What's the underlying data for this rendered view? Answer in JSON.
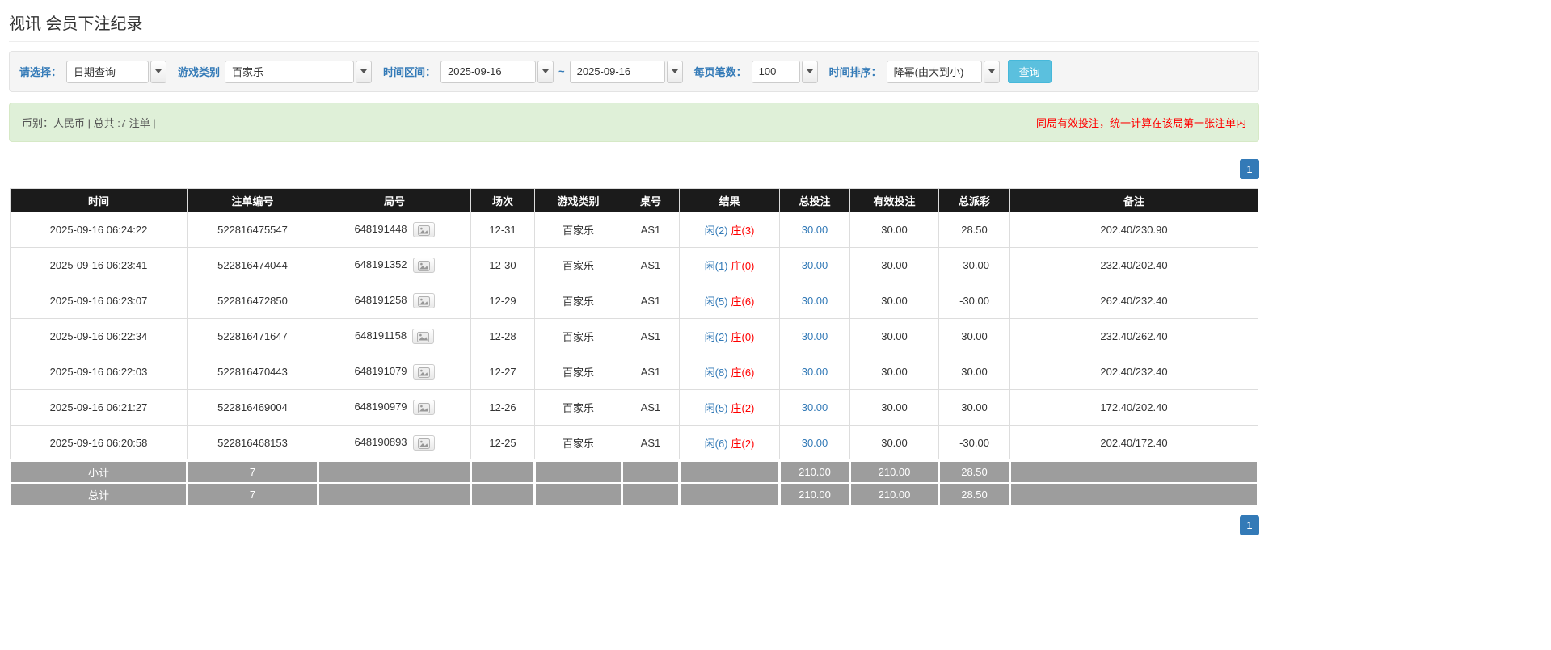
{
  "page": {
    "title": "视讯 会员下注纪录"
  },
  "filters": {
    "select_label": "请选择：",
    "select_value": "日期查询",
    "game_label": "游戏类别",
    "game_value": "百家乐",
    "range_label": "时间区间：",
    "date_from": "2025-09-16",
    "range_separator": "~",
    "date_to": "2025-09-16",
    "per_page_label": "每页笔数：",
    "per_page_value": "100",
    "sort_label": "时间排序：",
    "sort_value": "降幂(由大到小)",
    "search_label": "查询"
  },
  "summary": {
    "left_text": "币别：人民币 | 总共 :7 注单 |",
    "right_text": "同局有效投注，统一计算在该局第一张注单内"
  },
  "pagination": {
    "page": "1"
  },
  "table": {
    "headers": [
      "时间",
      "注单编号",
      "局号",
      "场次",
      "游戏类别",
      "桌号",
      "结果",
      "总投注",
      "有效投注",
      "总派彩",
      "备注"
    ],
    "rows": [
      {
        "time": "2025-09-16 06:24:22",
        "bet_id": "522816475547",
        "round_id": "648191448",
        "session": "12-31",
        "game_type": "百家乐",
        "table_no": "AS1",
        "result_player": "闲(2)",
        "result_banker": "庄(3)",
        "total_bet": "30.00",
        "valid_bet": "30.00",
        "payout": "28.50",
        "note": "202.40/230.90"
      },
      {
        "time": "2025-09-16 06:23:41",
        "bet_id": "522816474044",
        "round_id": "648191352",
        "session": "12-30",
        "game_type": "百家乐",
        "table_no": "AS1",
        "result_player": "闲(1)",
        "result_banker": "庄(0)",
        "total_bet": "30.00",
        "valid_bet": "30.00",
        "payout": "-30.00",
        "note": "232.40/202.40"
      },
      {
        "time": "2025-09-16 06:23:07",
        "bet_id": "522816472850",
        "round_id": "648191258",
        "session": "12-29",
        "game_type": "百家乐",
        "table_no": "AS1",
        "result_player": "闲(5)",
        "result_banker": "庄(6)",
        "total_bet": "30.00",
        "valid_bet": "30.00",
        "payout": "-30.00",
        "note": "262.40/232.40"
      },
      {
        "time": "2025-09-16 06:22:34",
        "bet_id": "522816471647",
        "round_id": "648191158",
        "session": "12-28",
        "game_type": "百家乐",
        "table_no": "AS1",
        "result_player": "闲(2)",
        "result_banker": "庄(0)",
        "total_bet": "30.00",
        "valid_bet": "30.00",
        "payout": "30.00",
        "note": "232.40/262.40"
      },
      {
        "time": "2025-09-16 06:22:03",
        "bet_id": "522816470443",
        "round_id": "648191079",
        "session": "12-27",
        "game_type": "百家乐",
        "table_no": "AS1",
        "result_player": "闲(8)",
        "result_banker": "庄(6)",
        "total_bet": "30.00",
        "valid_bet": "30.00",
        "payout": "30.00",
        "note": "202.40/232.40"
      },
      {
        "time": "2025-09-16 06:21:27",
        "bet_id": "522816469004",
        "round_id": "648190979",
        "session": "12-26",
        "game_type": "百家乐",
        "table_no": "AS1",
        "result_player": "闲(5)",
        "result_banker": "庄(2)",
        "total_bet": "30.00",
        "valid_bet": "30.00",
        "payout": "30.00",
        "note": "172.40/202.40"
      },
      {
        "time": "2025-09-16 06:20:58",
        "bet_id": "522816468153",
        "round_id": "648190893",
        "session": "12-25",
        "game_type": "百家乐",
        "table_no": "AS1",
        "result_player": "闲(6)",
        "result_banker": "庄(2)",
        "total_bet": "30.00",
        "valid_bet": "30.00",
        "payout": "-30.00",
        "note": "202.40/172.40"
      }
    ],
    "subtotal": {
      "label": "小计",
      "count": "7",
      "total_bet": "210.00",
      "valid_bet": "210.00",
      "payout": "28.50"
    },
    "grand_total": {
      "label": "总计",
      "count": "7",
      "total_bet": "210.00",
      "valid_bet": "210.00",
      "payout": "28.50"
    }
  },
  "colors": {
    "accent": "#337ab7",
    "search_button": "#5bc0de",
    "player_blue": "#337ab7",
    "banker_red": "#ff0000",
    "negative_red": "#ff0000",
    "summary_bg": "#dff0d8",
    "header_bg": "#1b1b1b",
    "footer_bg": "#9d9d9d"
  }
}
